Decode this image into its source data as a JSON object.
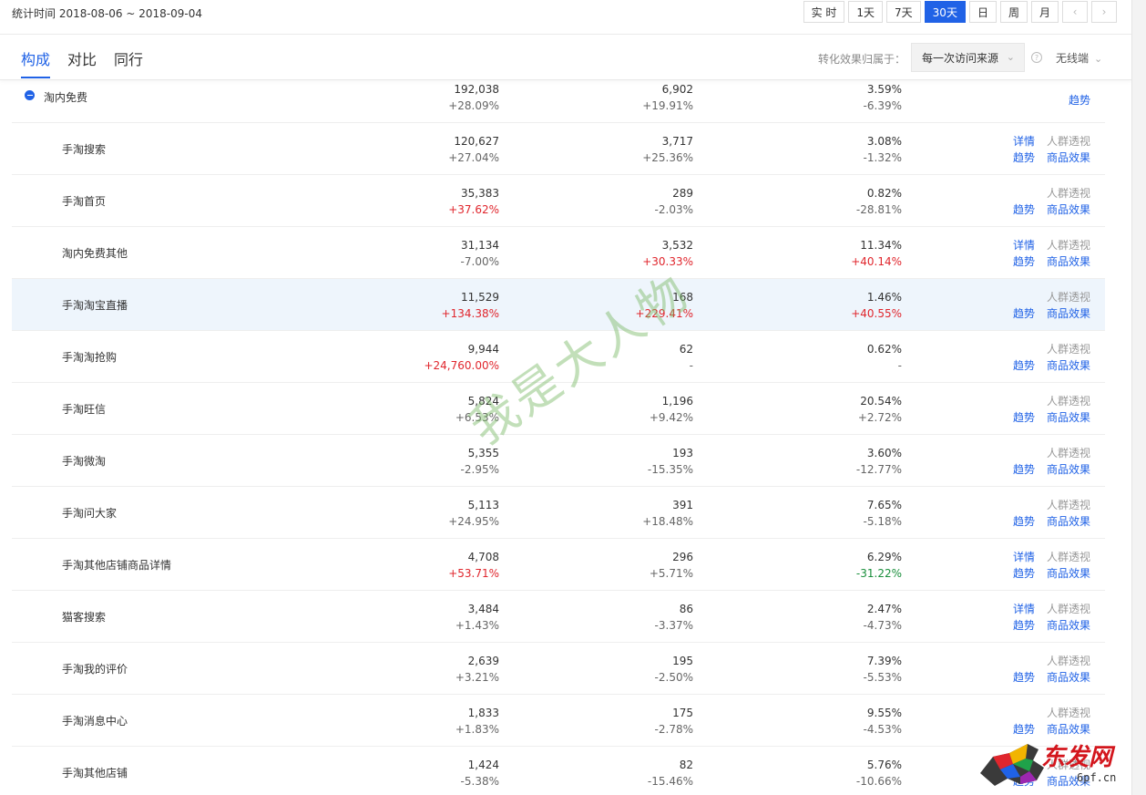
{
  "header": {
    "stat_time": "统计时间 2018-08-06 ~ 2018-09-04",
    "ranges": [
      "实 时",
      "1天",
      "7天",
      "30天",
      "日",
      "周",
      "月"
    ],
    "active_range": "30天"
  },
  "tabs": [
    {
      "label": "构成",
      "active": true
    },
    {
      "label": "对比",
      "active": false
    },
    {
      "label": "同行",
      "active": false
    }
  ],
  "attribution": {
    "label": "转化效果归属于：",
    "selected": "每一次访问来源",
    "device": "无线端"
  },
  "ops_labels": {
    "detail": "详情",
    "crowd": "人群透视",
    "trend": "趋势",
    "goods": "商品效果"
  },
  "rows": [
    {
      "name": "淘内免费",
      "v1": "192,038",
      "c1": "+28.09%",
      "v2": "6,902",
      "c2": "+19.91%",
      "v3": "3.59%",
      "c3": "-6.39%",
      "top": true
    },
    {
      "name": "手淘搜索",
      "v1": "120,627",
      "c1": "+27.04%",
      "v2": "3,717",
      "c2": "+25.36%",
      "v3": "3.08%",
      "c3": "-1.32%",
      "detail": true
    },
    {
      "name": "手淘首页",
      "v1": "35,383",
      "c1": "+37.62%",
      "c1_color": "red",
      "v2": "289",
      "c2": "-2.03%",
      "v3": "0.82%",
      "c3": "-28.81%"
    },
    {
      "name": "淘内免费其他",
      "v1": "31,134",
      "c1": "-7.00%",
      "v2": "3,532",
      "c2": "+30.33%",
      "c2_color": "red",
      "v3": "11.34%",
      "c3": "+40.14%",
      "c3_color": "red",
      "detail": true
    },
    {
      "name": "手淘淘宝直播",
      "v1": "11,529",
      "c1": "+134.38%",
      "c1_color": "red",
      "v2": "168",
      "c2": "+229.41%",
      "c2_color": "red",
      "v3": "1.46%",
      "c3": "+40.55%",
      "c3_color": "red",
      "highlight": true
    },
    {
      "name": "手淘淘抢购",
      "v1": "9,944",
      "c1": "+24,760.00%",
      "c1_color": "red",
      "v2": "62",
      "c2": "-",
      "v3": "0.62%",
      "c3": "-"
    },
    {
      "name": "手淘旺信",
      "v1": "5,824",
      "c1": "+6.53%",
      "v2": "1,196",
      "c2": "+9.42%",
      "v3": "20.54%",
      "c3": "+2.72%"
    },
    {
      "name": "手淘微淘",
      "v1": "5,355",
      "c1": "-2.95%",
      "v2": "193",
      "c2": "-15.35%",
      "v3": "3.60%",
      "c3": "-12.77%"
    },
    {
      "name": "手淘问大家",
      "v1": "5,113",
      "c1": "+24.95%",
      "v2": "391",
      "c2": "+18.48%",
      "v3": "7.65%",
      "c3": "-5.18%"
    },
    {
      "name": "手淘其他店铺商品详情",
      "v1": "4,708",
      "c1": "+53.71%",
      "c1_color": "red",
      "v2": "296",
      "c2": "+5.71%",
      "v3": "6.29%",
      "c3": "-31.22%",
      "c3_color": "green",
      "detail": true
    },
    {
      "name": "猫客搜索",
      "v1": "3,484",
      "c1": "+1.43%",
      "v2": "86",
      "c2": "-3.37%",
      "v3": "2.47%",
      "c3": "-4.73%",
      "detail": true
    },
    {
      "name": "手淘我的评价",
      "v1": "2,639",
      "c1": "+3.21%",
      "v2": "195",
      "c2": "-2.50%",
      "v3": "7.39%",
      "c3": "-5.53%"
    },
    {
      "name": "手淘消息中心",
      "v1": "1,833",
      "c1": "+1.83%",
      "v2": "175",
      "c2": "-2.78%",
      "v3": "9.55%",
      "c3": "-4.53%"
    },
    {
      "name": "手淘其他店铺",
      "v1": "1,424",
      "c1": "-5.38%",
      "v2": "82",
      "c2": "-15.46%",
      "v3": "5.76%",
      "c3": "-10.66%"
    }
  ],
  "watermark": "我是大人物",
  "logo": {
    "text": "东发网",
    "url": "6pf.cn"
  }
}
